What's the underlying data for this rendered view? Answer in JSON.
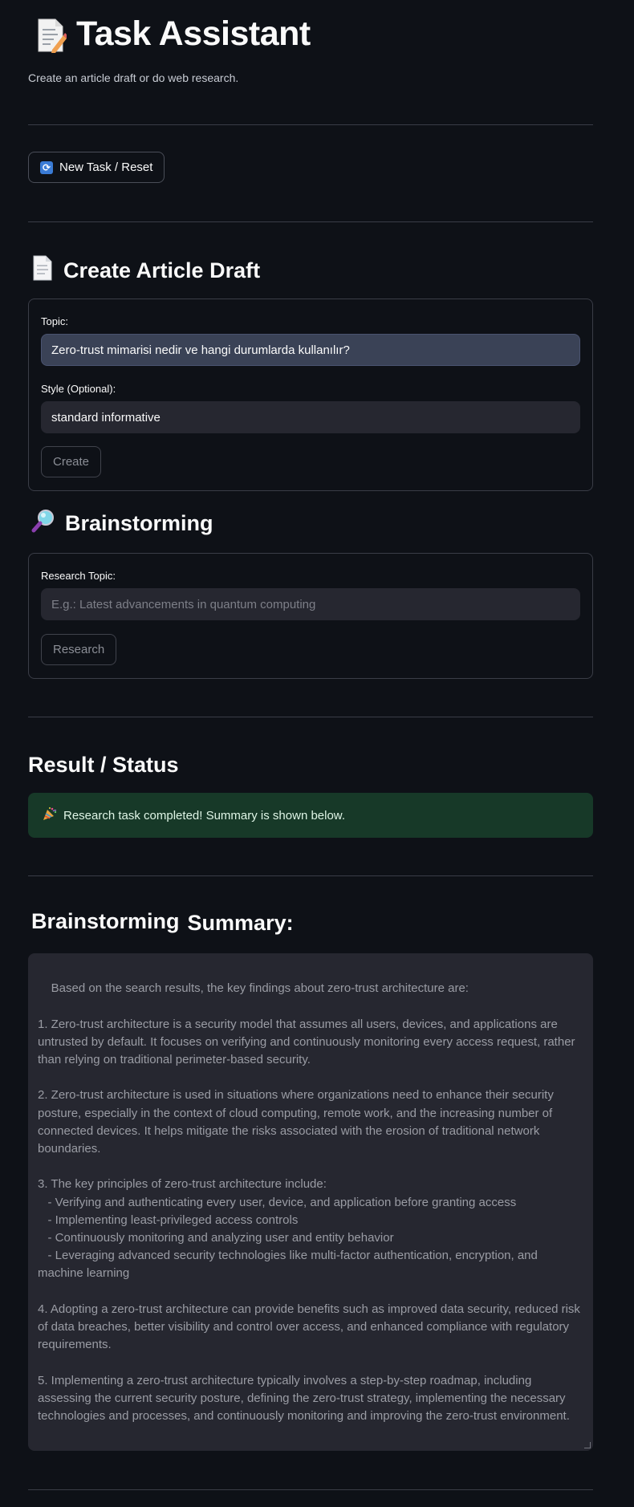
{
  "header": {
    "title": "Task Assistant",
    "subtitle": "Create an article draft or do web research."
  },
  "reset_button": {
    "label": "New Task / Reset"
  },
  "article_section": {
    "title": "Create Article Draft",
    "topic_label": "Topic:",
    "topic_value": "Zero-trust mimarisi nedir ve hangi durumlarda kullanılır?",
    "style_label": "Style (Optional):",
    "style_value": "standard informative",
    "create_label": "Create"
  },
  "brainstorm_section": {
    "title": "Brainstorming",
    "research_label": "Research Topic:",
    "research_placeholder": "E.g.: Latest advancements in quantum computing",
    "research_button": "Research"
  },
  "result_section": {
    "title": "Result / Status",
    "status_message": "Research task completed! Summary is shown below."
  },
  "summary_section": {
    "title_left": "Brainstorming",
    "title_right": "Summary:",
    "text": "Based on the search results, the key findings about zero-trust architecture are:\n\n1. Zero-trust architecture is a security model that assumes all users, devices, and applications are untrusted by default. It focuses on verifying and continuously monitoring every access request, rather than relying on traditional perimeter-based security.\n\n2. Zero-trust architecture is used in situations where organizations need to enhance their security posture, especially in the context of cloud computing, remote work, and the increasing number of connected devices. It helps mitigate the risks associated with the erosion of traditional network boundaries.\n\n3. The key principles of zero-trust architecture include:\n   - Verifying and authenticating every user, device, and application before granting access\n   - Implementing least-privileged access controls\n   - Continuously monitoring and analyzing user and entity behavior\n   - Leveraging advanced security technologies like multi-factor authentication, encryption, and machine learning\n\n4. Adopting a zero-trust architecture can provide benefits such as improved data security, reduced risk of data breaches, better visibility and control over access, and enhanced compliance with regulatory requirements.\n\n5. Implementing a zero-trust architecture typically involves a step-by-step roadmap, including assessing the current security posture, defining the zero-trust strategy, implementing the necessary technologies and processes, and continuously monitoring and improving the zero-trust environment."
  },
  "icons": {
    "title_icon": "memo-icon",
    "reset_icon": "arrows-cycle-icon",
    "article_icon": "page-icon",
    "brainstorm_icon": "magnifier-icon",
    "status_icon": "party-popper-icon"
  },
  "colors": {
    "background": "#0e1117",
    "input_bg": "#262730",
    "success_bg": "#173928",
    "text": "#fafafa"
  }
}
